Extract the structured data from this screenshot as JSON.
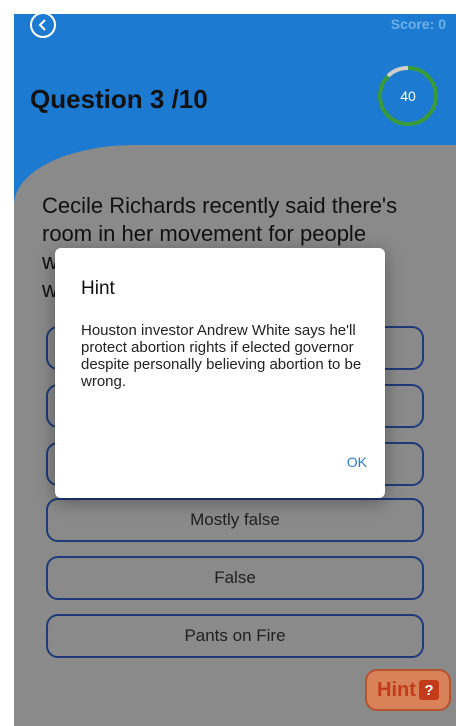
{
  "header": {
    "score": "Score: 0",
    "question_title": "Question 3 /10"
  },
  "timer": {
    "value": "40",
    "fraction_elapsed": 0.12,
    "ring_color": "#3a9a3a",
    "elapsed_color": "#cfcfcf"
  },
  "question": {
    "text": "Cecile Richards recently said there's room in her movement for people w... w..."
  },
  "options": [
    "Mostly false",
    "False",
    "Pants on Fire"
  ],
  "hint_button": {
    "label": "Hint",
    "icon": "question-box-icon",
    "glyph": "?"
  },
  "dialog": {
    "title": "Hint",
    "body": "Houston investor Andrew White says he'll protect abortion rights if elected governor despite personally believing abortion to be wrong.",
    "ok": "OK"
  },
  "colors": {
    "header_blue": "#1c7ad1",
    "accent_blue": "#2a7fd4",
    "hint_red": "#c23b1a"
  }
}
